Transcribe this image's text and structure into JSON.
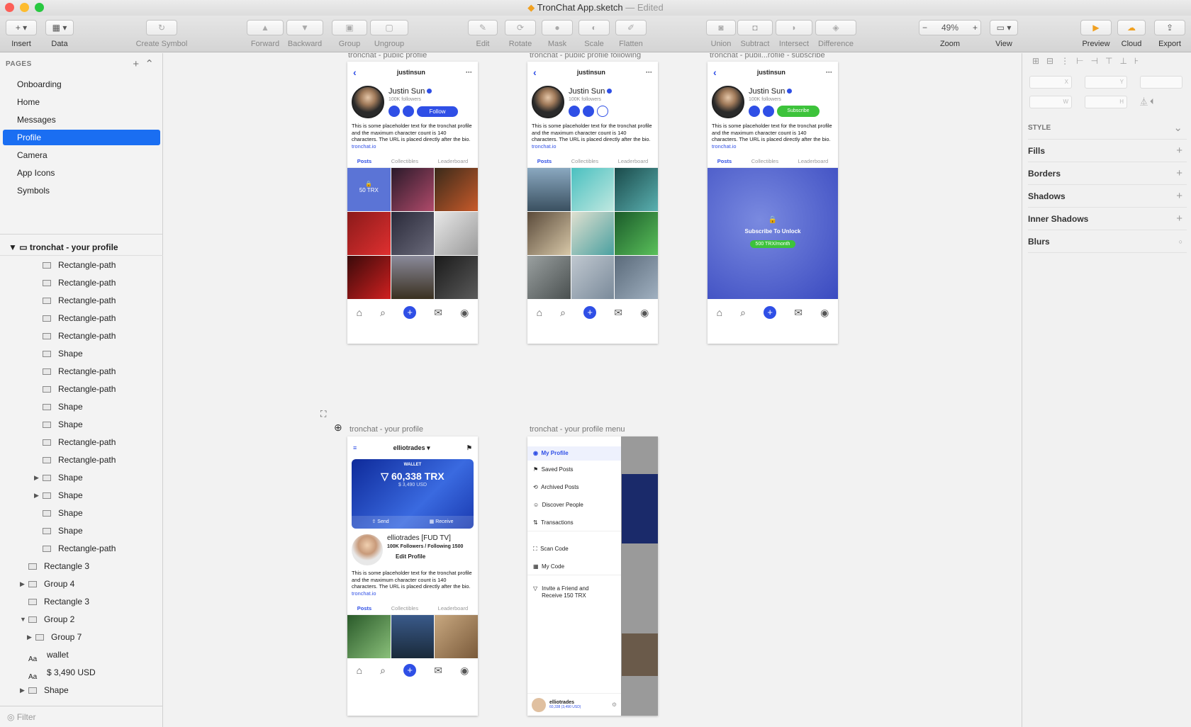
{
  "window": {
    "title": "TronChat App.sketch",
    "edited": "— Edited"
  },
  "toolbar": {
    "insert": "Insert",
    "data": "Data",
    "create_symbol": "Create Symbol",
    "forward": "Forward",
    "backward": "Backward",
    "group": "Group",
    "ungroup": "Ungroup",
    "edit": "Edit",
    "rotate": "Rotate",
    "mask": "Mask",
    "scale": "Scale",
    "flatten": "Flatten",
    "union": "Union",
    "subtract": "Subtract",
    "intersect": "Intersect",
    "difference": "Difference",
    "zoom_label": "Zoom",
    "zoom_value": "49%",
    "view": "View",
    "preview": "Preview",
    "cloud": "Cloud",
    "export": "Export"
  },
  "pages": {
    "header": "PAGES",
    "items": [
      "Onboarding",
      "Home",
      "Messages",
      "Profile",
      "Camera",
      "App Icons",
      "Symbols"
    ],
    "selected": "Profile"
  },
  "layers": {
    "root": "tronchat - your profile",
    "items": [
      "Rectangle-path",
      "Rectangle-path",
      "Rectangle-path",
      "Rectangle-path",
      "Rectangle-path",
      "Shape",
      "Rectangle-path",
      "Rectangle-path",
      "Shape",
      "Shape",
      "Rectangle-path",
      "Rectangle-path",
      "Shape",
      "Shape",
      "Shape",
      "Shape",
      "Rectangle-path",
      "Rectangle 3",
      "Group 4",
      "Rectangle 3",
      "Group 2",
      "Group 7",
      "wallet",
      "$ 3,490 USD",
      "Shape"
    ],
    "filter": "Filter"
  },
  "artboards": {
    "a1": "tronchat - public profile",
    "a2": "tronchat - public profile following",
    "a3": "tronchat - publi...rofile - subscribe",
    "a4": "tronchat - your profile",
    "a5": "tronchat - your profile menu"
  },
  "profile": {
    "username": "justinsun",
    "name": "Justin Sun",
    "followers": "100K followers",
    "follow": "Follow",
    "subscribe": "Subscribe",
    "bio": "This is some placeholder text for the tronchat profile and the maximum character count is 140 characters. The URL is placed directly after the bio.",
    "link": "tronchat.io",
    "tabs": [
      "Posts",
      "Collectibles",
      "Leaderboard"
    ],
    "locked_price": "50 TRX",
    "unlock": "Subscribe To Unlock",
    "unlock_price": "500 TRX/month"
  },
  "own": {
    "username": "elliotrades",
    "wallet": "WALLET",
    "balance": "60,338 TRX",
    "usd": "$ 3,490 USD",
    "send": "Send",
    "receive": "Receive",
    "name": "elliotrades [FUD TV]",
    "stats": "100K Followers / Following 1500",
    "edit_profile": "Edit Profile"
  },
  "menu": {
    "items": [
      "My Profile",
      "Saved Posts",
      "Archived Posts",
      "Discover People",
      "Transactions",
      "Scan Code",
      "My Code"
    ],
    "invite": "Invite a Friend and Receive 150 TRX",
    "footer_name": "elliotrades",
    "footer_balance": "60,338 (3,490 USD)"
  },
  "inspector": {
    "style": "STYLE",
    "fills": "Fills",
    "borders": "Borders",
    "shadows": "Shadows",
    "inner_shadows": "Inner Shadows",
    "blurs": "Blurs",
    "x": "X",
    "y": "Y",
    "w": "W",
    "h": "H"
  },
  "colors": {
    "accent": "#1a6ef2",
    "tron_blue": "#2f4fe6",
    "subscribe_green": "#3dc33b"
  }
}
